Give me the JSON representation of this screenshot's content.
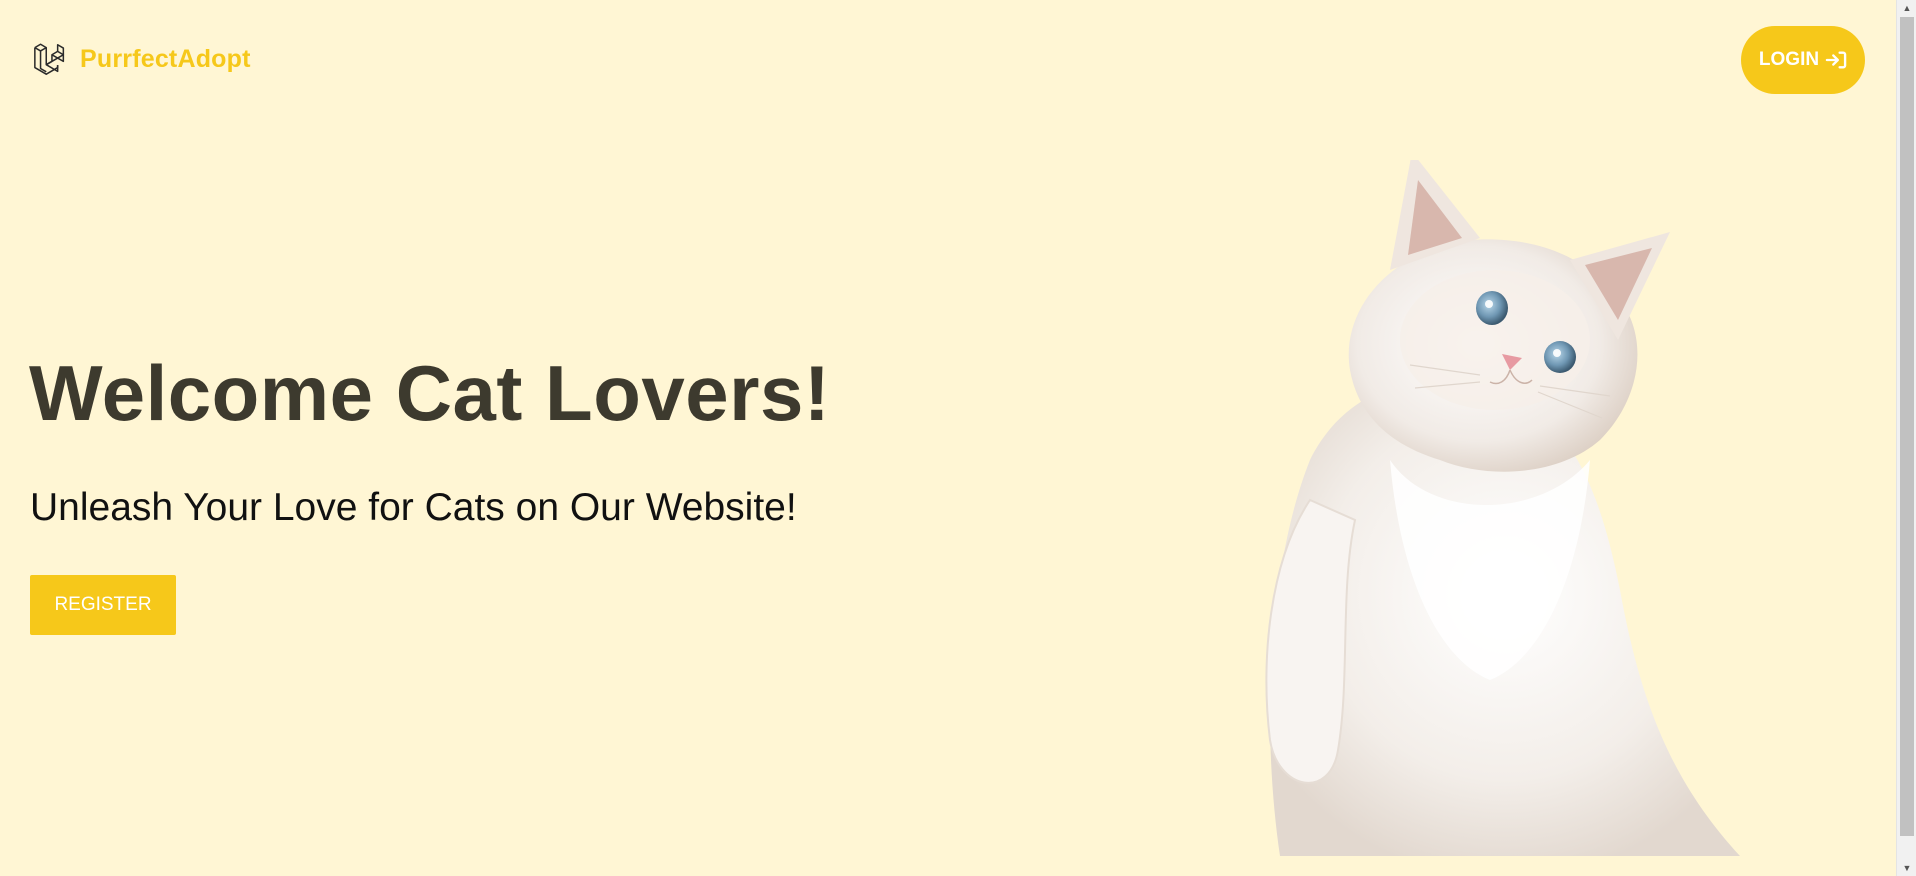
{
  "header": {
    "brand_name": "PurrfectAdopt",
    "logo_icon": "laravel-logo-icon",
    "login_label": "LOGIN",
    "login_icon": "sign-in-icon"
  },
  "hero": {
    "title": "Welcome Cat Lovers!",
    "subtitle": "Unleash Your Love for Cats on Our Website!",
    "register_label": "REGISTER"
  },
  "colors": {
    "background": "#fff6d4",
    "accent": "#f6c81a",
    "title": "#3d3a2e",
    "text": "#111111"
  }
}
